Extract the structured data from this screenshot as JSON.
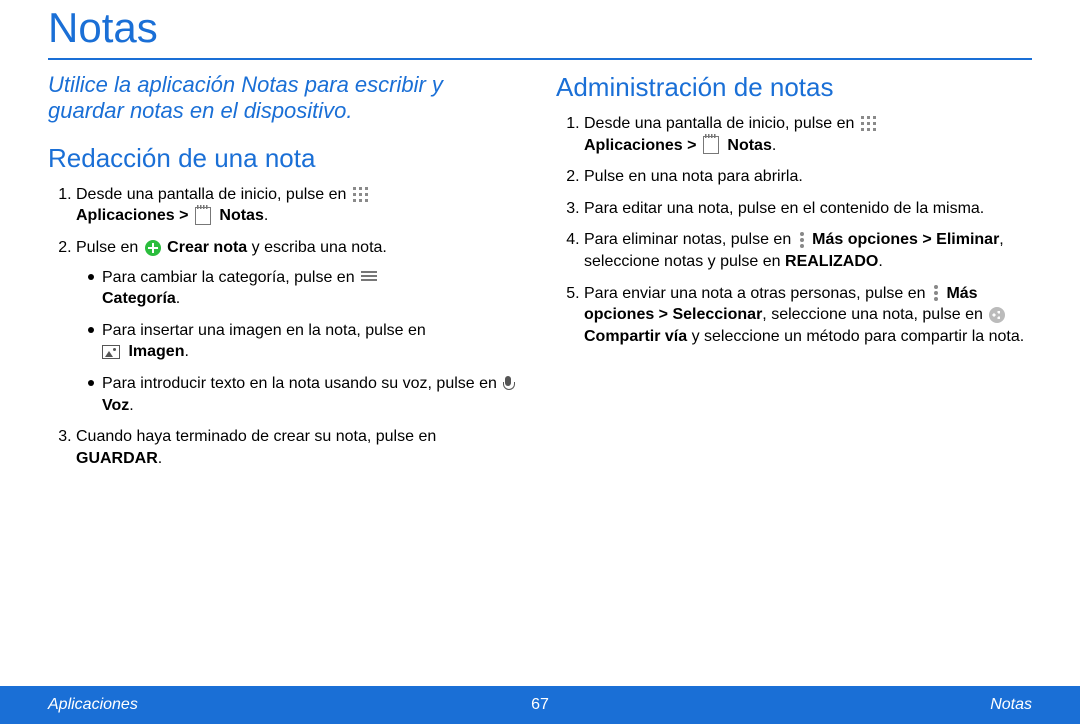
{
  "title": "Notas",
  "intro": "Utilice la aplicación Notas para escribir y guardar notas en el dispositivo.",
  "left": {
    "heading": "Redacción de una nota",
    "steps": {
      "s1a": "Desde una pantalla de inicio, pulse en ",
      "s1b": "Aplicaciones > ",
      "s1c": " Notas",
      "s2a": "Pulse en ",
      "s2b": " Crear nota",
      "s2c": " y escriba una nota.",
      "sub1a": "Para cambiar la categoría, pulse en ",
      "sub1b": "Categoría",
      "sub2a": "Para insertar una imagen en la nota, pulse en ",
      "sub2b": " Imagen",
      "sub3a": "Para introducir texto en la nota usando su voz, pulse en ",
      "sub3b": " Voz",
      "s3a": "Cuando haya terminado de crear su nota, pulse en ",
      "s3b": "GUARDAR"
    }
  },
  "right": {
    "heading": "Administración de notas",
    "steps": {
      "s1a": "Desde una pantalla de inicio, pulse en ",
      "s1b": "Aplicaciones > ",
      "s1c": " Notas",
      "s2": "Pulse en una nota para abrirla.",
      "s3": "Para editar una nota, pulse en el contenido de la misma.",
      "s4a": "Para eliminar notas, pulse en ",
      "s4b": " Más opciones > Eliminar",
      "s4c": ", seleccione notas y pulse en ",
      "s4d": "REALIZADO",
      "s5a": "Para enviar una nota a otras personas, pulse en ",
      "s5b": "Más opciones > Seleccionar",
      "s5c": ", seleccione una nota, pulse en ",
      "s5d": " Compartir vía",
      "s5e": "  y seleccione un método para compartir la nota."
    }
  },
  "footer": {
    "left": "Aplicaciones",
    "page": "67",
    "right": "Notas"
  }
}
